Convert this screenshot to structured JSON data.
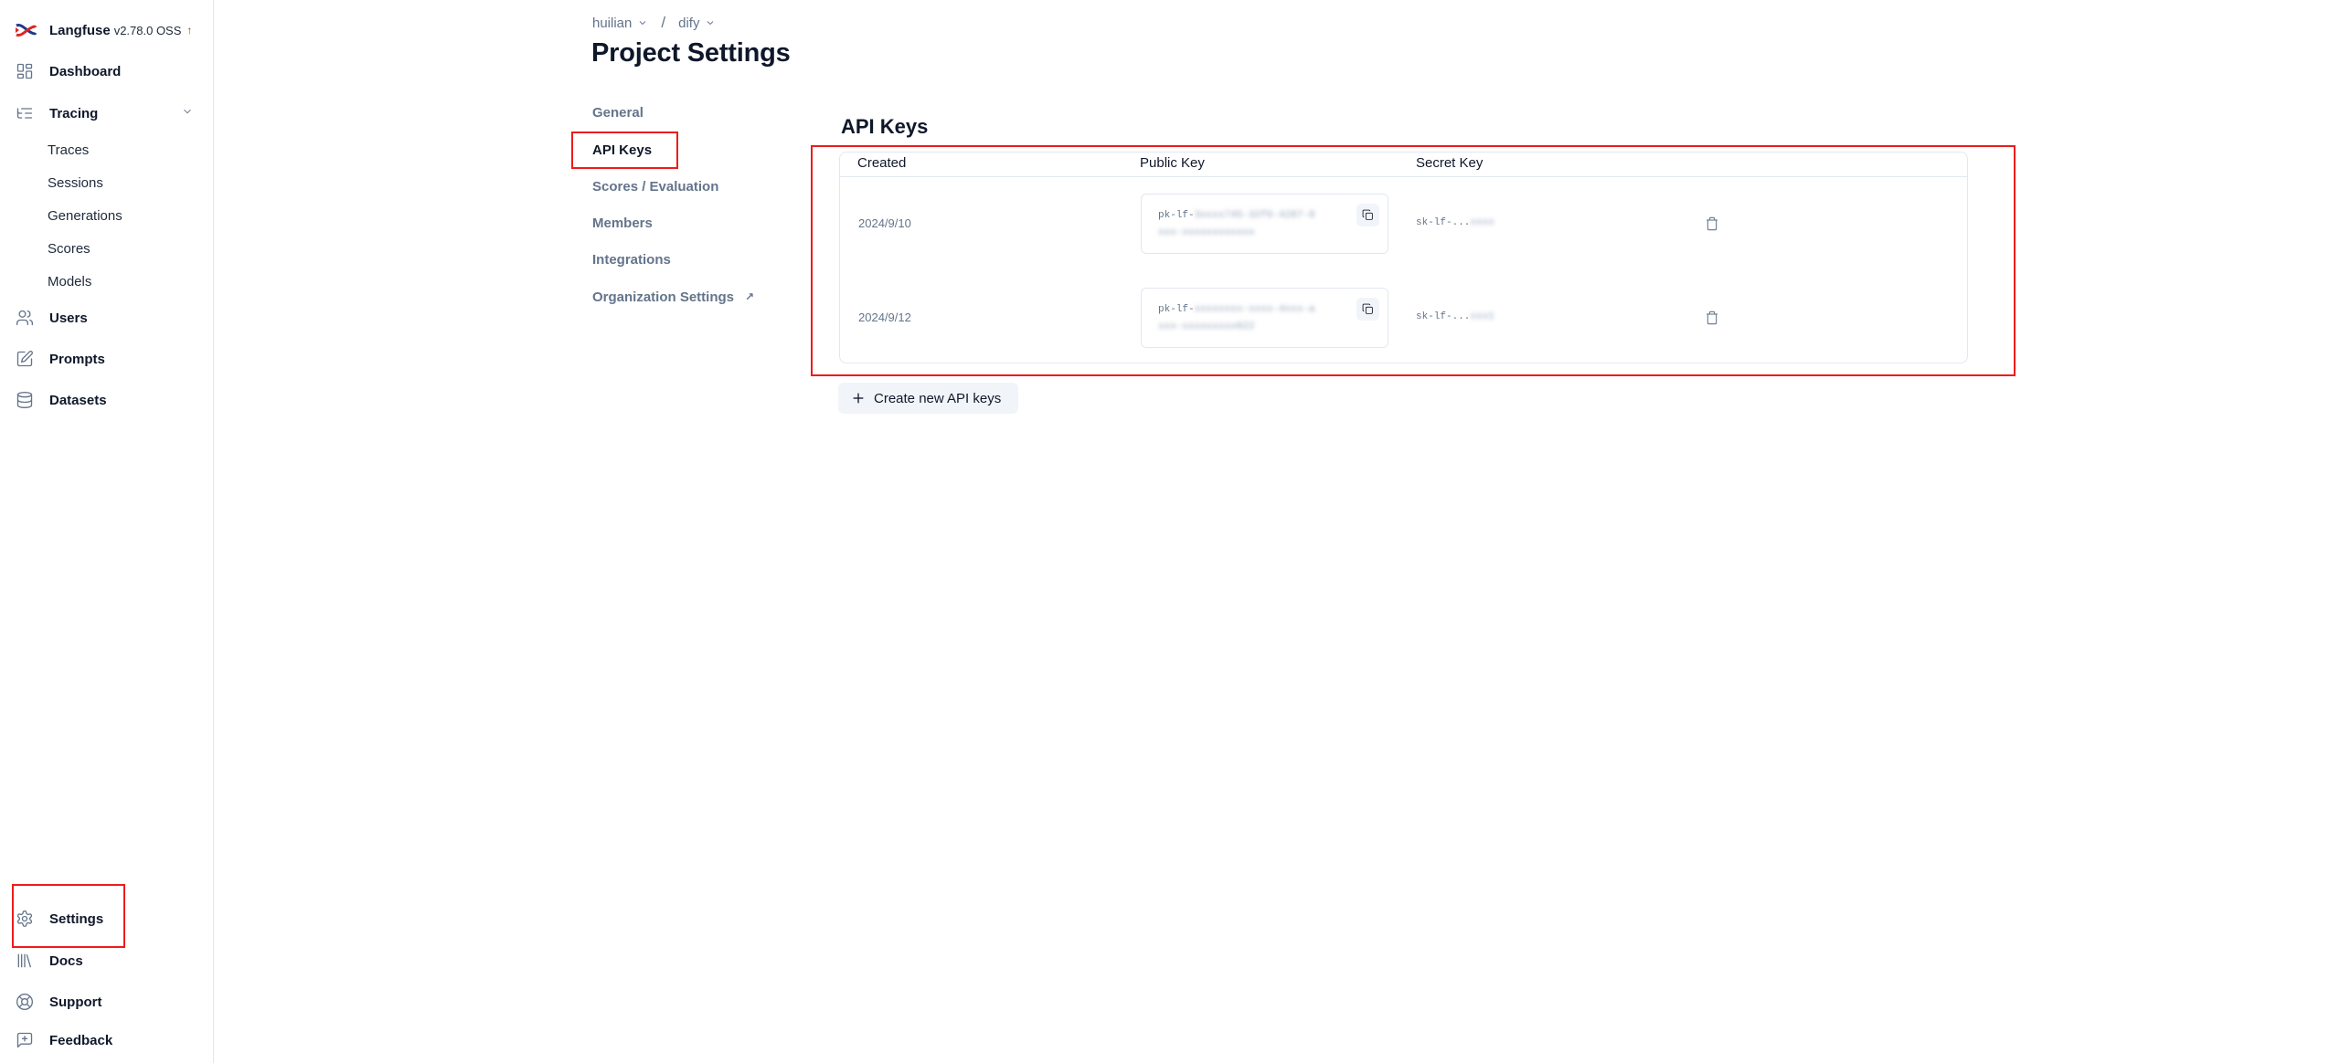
{
  "sidebar": {
    "brand": {
      "name": "Langfuse",
      "version": "v2.78.0 OSS",
      "update_icon": "arrow-up-icon"
    },
    "items": [
      {
        "label": "Dashboard",
        "icon": "dashboard-grid-icon"
      },
      {
        "label": "Tracing",
        "icon": "list-tree-icon",
        "expanded": true,
        "children": [
          "Traces",
          "Sessions",
          "Generations",
          "Scores",
          "Models"
        ]
      },
      {
        "label": "Users",
        "icon": "users-icon"
      },
      {
        "label": "Prompts",
        "icon": "pencil-square-icon"
      },
      {
        "label": "Datasets",
        "icon": "database-icon"
      }
    ],
    "bottom_items": [
      {
        "label": "Settings",
        "icon": "gear-icon",
        "highlighted": true
      },
      {
        "label": "Docs",
        "icon": "library-books-icon"
      },
      {
        "label": "Support",
        "icon": "life-buoy-icon"
      },
      {
        "label": "Feedback",
        "icon": "message-plus-icon"
      }
    ]
  },
  "breadcrumb": {
    "organization": "huilian",
    "separator": "/",
    "project": "dify"
  },
  "page": {
    "title": "Project Settings"
  },
  "tabs": [
    {
      "label": "General",
      "active": false
    },
    {
      "label": "API Keys",
      "active": true,
      "highlighted": true
    },
    {
      "label": "Scores / Evaluation",
      "active": false
    },
    {
      "label": "Members",
      "active": false
    },
    {
      "label": "Integrations",
      "active": false
    },
    {
      "label": "Organization Settings",
      "active": false,
      "external": true,
      "external_icon": "↗"
    }
  ],
  "api_keys": {
    "title": "API Keys",
    "columns": [
      "Created",
      "Public Key",
      "Secret Key"
    ],
    "rows": [
      {
        "created": "2024/9/10",
        "public_key_prefix": "pk-lf-",
        "public_key_redacted_1": "3xxxx745-32f6-4287-8",
        "public_key_redacted_2": "xxx-xxxxxxxxxxxx",
        "secret_key_prefix": "sk-lf-...",
        "secret_key_redacted": "xxxx"
      },
      {
        "created": "2024/9/12",
        "public_key_prefix": "pk-lf-",
        "public_key_redacted_1": "xxxxxxxx-xxxx-4xxx-a",
        "public_key_redacted_2": "xxx-xxxxxxxxx622",
        "secret_key_prefix": "sk-lf-...",
        "secret_key_redacted": "xxx1"
      }
    ],
    "create_button": "Create new API keys"
  },
  "colors": {
    "highlight_box": "#ef1b1b",
    "muted_text": "#64748b",
    "border": "#e2e8f0",
    "button_bg": "#f1f5f9"
  }
}
